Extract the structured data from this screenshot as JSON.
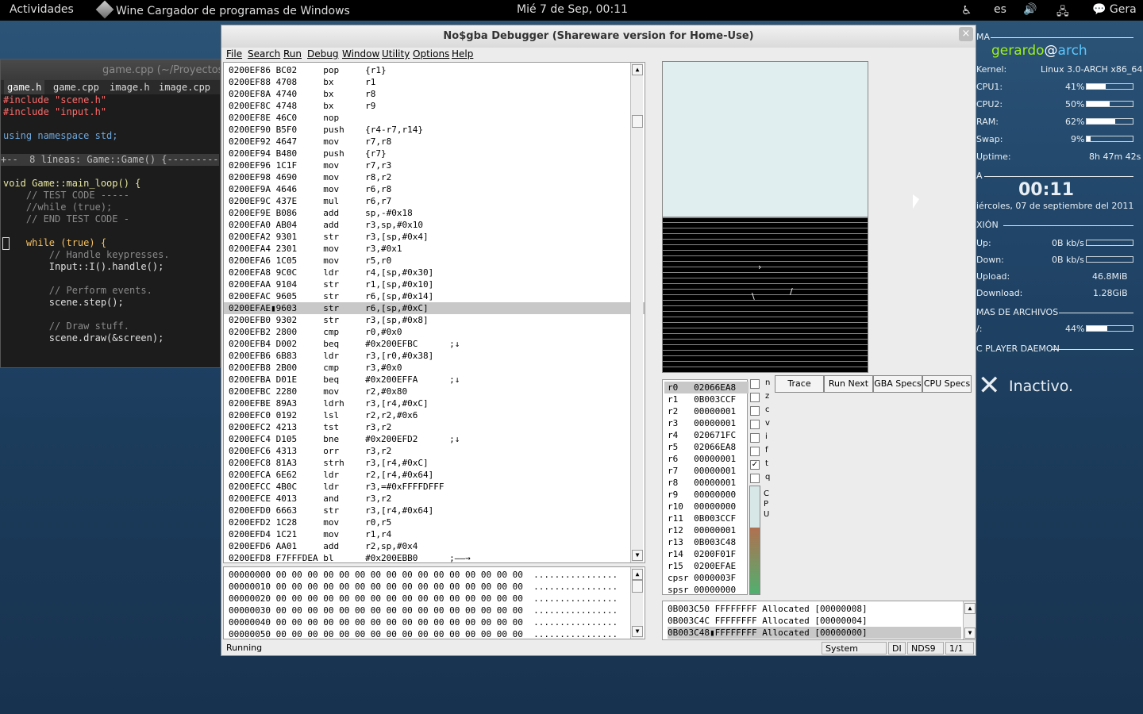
{
  "topbar": {
    "activities": "Actividades",
    "app": "Wine Cargador de programas de Windows",
    "clock": "Mié  7 de Sep, 00:11",
    "lang": "es",
    "user": "Gera"
  },
  "conky": {
    "header1": "MA",
    "user": "gerardo",
    "at": "@",
    "host": "arch",
    "kernel_label": "Kernel:",
    "kernel_value": "Linux 3.0-ARCH x86_64",
    "cpu1_label": "CPU1:",
    "cpu1_value": "41%",
    "cpu1_level": 0.41,
    "cpu2_label": "CPU2:",
    "cpu2_value": "50%",
    "cpu2_level": 0.5,
    "ram_label": "RAM:",
    "ram_value": "62%",
    "ram_level": 0.62,
    "swap_label": "Swap:",
    "swap_value": "9%",
    "swap_level": 0.09,
    "uptime_label": "Uptime:",
    "uptime_value": "8h 47m 42s",
    "header2": "A",
    "time": "00:11",
    "date": "iércoles, 07 de septiembre del 2011",
    "header3": "XIÓN",
    "up_label": "Up:",
    "up_value": "0B kb/s",
    "down_label": "Down:",
    "down_value": "0B kb/s",
    "upload_label": "Upload:",
    "upload_value": "46.8MiB",
    "download_label": "Download:",
    "download_value": "1.28GiB",
    "header4": "MAS DE ARCHIVOS",
    "fs_label": "/:",
    "fs_value": "44%",
    "fs_level": 0.44,
    "header5": "C PLAYER DAEMON",
    "mpd_status": "Inactivo."
  },
  "editor": {
    "title": "game.cpp (~/Proyectos",
    "tabs": [
      "game.h",
      "game.cpp",
      "image.h",
      "image.cpp"
    ],
    "lines": [
      "#include \"scene.h\"",
      "#include \"input.h\"",
      "",
      "using namespace std;",
      "",
      "+--  8 líneas: Game::Game() {----------",
      "",
      "void Game::main_loop() {",
      "    // TEST CODE -----",
      "    //while (true);",
      "    // END TEST CODE -",
      "",
      "    while (true) {",
      "        // Handle keypresses.",
      "        Input::I().handle();",
      "",
      "        // Perform events.",
      "        scene.step();",
      "",
      "        // Draw stuff.",
      "        scene.draw(&screen);"
    ]
  },
  "nocash": {
    "title": "No$gba Debugger (Shareware version for Home-Use)",
    "close": "×",
    "menu": [
      "File",
      "Search",
      "Run",
      "Debug",
      "Window",
      "Utility",
      "Options",
      "Help"
    ],
    "disasm": [
      "0200EF86 BC02     pop     {r1}",
      "0200EF88 4708     bx      r1",
      "0200EF8A 4740     bx      r8",
      "0200EF8C 4748     bx      r9",
      "0200EF8E 46C0     nop",
      "0200EF90 B5F0     push    {r4-r7,r14}",
      "0200EF92 4647     mov     r7,r8",
      "0200EF94 B480     push    {r7}",
      "0200EF96 1C1F     mov     r7,r3",
      "0200EF98 4690     mov     r8,r2",
      "0200EF9A 4646     mov     r6,r8",
      "0200EF9C 437E     mul     r6,r7",
      "0200EF9E B086     add     sp,-#0x18",
      "0200EFA0 AB04     add     r3,sp,#0x10",
      "0200EFA2 9301     str     r3,[sp,#0x4]",
      "0200EFA4 2301     mov     r3,#0x1",
      "0200EFA6 1C05     mov     r5,r0",
      "0200EFA8 9C0C     ldr     r4,[sp,#0x30]",
      "0200EFAA 9104     str     r1,[sp,#0x10]",
      "0200EFAC 9605     str     r6,[sp,#0x14]",
      "0200EFAE▮9603     str     r6,[sp,#0xC]",
      "0200EFB0 9302     str     r3,[sp,#0x8]",
      "0200EFB2 2800     cmp     r0,#0x0",
      "0200EFB4 D002     beq     #0x200EFBC      ;↓",
      "0200EFB6 6B83     ldr     r3,[r0,#0x38]",
      "0200EFB8 2B00     cmp     r3,#0x0",
      "0200EFBA D01E     beq     #0x200EFFA      ;↓",
      "0200EFBC 2280     mov     r2,#0x80",
      "0200EFBE 89A3     ldrh    r3,[r4,#0xC]",
      "0200EFC0 0192     lsl     r2,r2,#0x6",
      "0200EFC2 4213     tst     r3,r2",
      "0200EFC4 D105     bne     #0x200EFD2      ;↓",
      "0200EFC6 4313     orr     r3,r2",
      "0200EFC8 81A3     strh    r3,[r4,#0xC]",
      "0200EFCA 6E62     ldr     r2,[r4,#0x64]",
      "0200EFCC 4B0C     ldr     r3,=#0xFFFFDFFF",
      "0200EFCE 4013     and     r3,r2",
      "0200EFD0 6663     str     r3,[r4,#0x64]",
      "0200EFD2 1C28     mov     r0,r5",
      "0200EFD4 1C21     mov     r1,r4",
      "0200EFD6 AA01     add     r2,sp,#0x4",
      "0200EFD8 F7FFFDEA bl      #0x200EBB0      ;——→"
    ],
    "hex": [
      "00000000 00 00 00 00 00 00 00 00 00 00 00 00 00 00 00 00  ................",
      "00000010 00 00 00 00 00 00 00 00 00 00 00 00 00 00 00 00  ................",
      "00000020 00 00 00 00 00 00 00 00 00 00 00 00 00 00 00 00  ................",
      "00000030 00 00 00 00 00 00 00 00 00 00 00 00 00 00 00 00  ................",
      "00000040 00 00 00 00 00 00 00 00 00 00 00 00 00 00 00 00  ................",
      "00000050 00 00 00 00 00 00 00 00 00 00 00 00 00 00 00 00  ................"
    ],
    "regs": [
      "r0   02066EA8",
      "r1   0B003CCF",
      "r2   00000001",
      "r3   00000001",
      "r4   020671FC",
      "r5   02066EA8",
      "r6   00000001",
      "r7   00000001",
      "r8   00000001",
      "r9   00000000",
      "r10  00000000",
      "r11  0B003CCF",
      "r12  00000001",
      "r13  0B003C48",
      "r14  0200F01F",
      "r15  0200EFAE",
      "cpsr 0000003F",
      "spsr 00000000"
    ],
    "flags": [
      {
        "label": "n",
        "checked": ""
      },
      {
        "label": "z",
        "checked": ""
      },
      {
        "label": "c",
        "checked": ""
      },
      {
        "label": "v",
        "checked": ""
      },
      {
        "label": "i",
        "checked": ""
      },
      {
        "label": "f",
        "checked": ""
      },
      {
        "label": "t",
        "checked": "✓"
      },
      {
        "label": "q",
        "checked": ""
      }
    ],
    "cpu_letters": [
      "C",
      "P",
      "U"
    ],
    "cpu_level": 0.62,
    "buttons": [
      "Trace",
      "Run Next",
      "GBA Specs",
      "CPU Specs"
    ],
    "memlist": [
      "0B003C50 FFFFFFFF Allocated [00000008]",
      "0B003C4C FFFFFFFF Allocated [00000004]",
      "0B003C48▮FFFFFFFF Allocated [00000000]"
    ],
    "status": {
      "state": "Running",
      "mode": "System",
      "di": "DI",
      "cpu": "NDS9",
      "page": "1/1"
    }
  }
}
